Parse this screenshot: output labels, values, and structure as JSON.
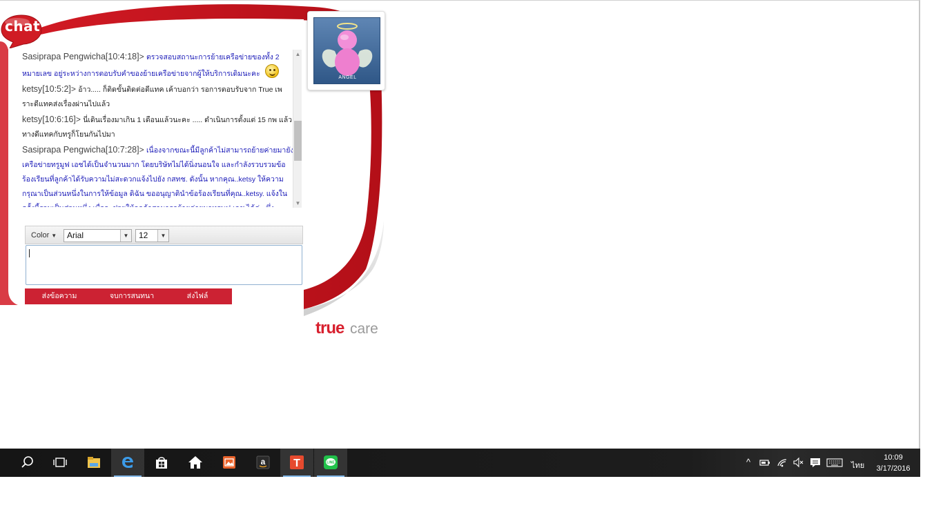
{
  "chat": {
    "bubble_label": "chat",
    "messages": [
      {
        "sender": "Sasiprapa Pengwicha",
        "time": "[10:4:18]",
        "sep": ">",
        "text": "ตรวจสอบสถานะการย้ายเครือข่ายของทั้ง 2 หมายเลข อยู่ระหว่างการตอบรับคำของย้ายเครือข่ายจากผู้ให้บริการเดิมนะคะ",
        "role": "agent",
        "emoticon": "smiley-icon"
      },
      {
        "sender": "ketsy",
        "time": "[10:5:2]",
        "sep": ">",
        "text": "อ้าว..... ก็ติดขั้นติดต่อดีแทค เค้าบอกว่า รอการตอบรับจาก True เพราะดีแทคส่งเรื่องผ่านไปแล้ว",
        "role": "user"
      },
      {
        "sender": "ketsy",
        "time": "[10:6:16]",
        "sep": ">",
        "text": "นี่เดินเรื่องมาเกิน 1 เดือนแล้วนะคะ ..... ดำเนินการตั้งแต่ 15 กพ แล้วทางดีแทคกับทรูก็โยนกันไปมา",
        "role": "user"
      },
      {
        "sender": "Sasiprapa Pengwicha",
        "time": "[10:7:28]",
        "sep": ">",
        "text": "เนื่องจากขณะนี้มีลูกค้าไม่สามารถย้ายค่ายมายังเครือข่ายทรูมูฟ เอชได้เป็นจำนวนมาก โดยบริษัทไม่ได้นิ่งนอนใจ และกำลังรวบรวมข้อร้องเรียนที่ลูกค้าได้รับความไม่สะดวกแจ้งไปยัง กสทช. ดังนั้น หากคุณ..ketsy ให้ความกรุณาเป็นส่วนหนึ่งในการให้ข้อมูล ดิฉัน ขออนุญาตินำข้อร้องเรียนที่คุณ..ketsy. แจ้งในครั้งนี้รวมเป็นส่วนหนึ่ง เพื่อจะช่วยให้ลูกค้าสามารถย้ายค่ายมาทรูมูฟ เอช ได้ค่ะ ซึ่ง",
        "role": "agent"
      }
    ],
    "toolbar": {
      "color_label": "Color",
      "font_value": "Arial",
      "size_value": "12"
    },
    "input_value": "",
    "actions": {
      "send": "ส่งข้อความ",
      "end": "จบการสนทนา",
      "send_file": "ส่งไฟล์"
    },
    "avatar": {
      "label": "ANGEL"
    }
  },
  "brand": {
    "true_text": "true",
    "care_text": "care",
    "accent_color": "#d8202e"
  },
  "taskbar": {
    "apps": [
      {
        "name": "search-icon"
      },
      {
        "name": "task-view-icon"
      },
      {
        "name": "file-explorer-icon"
      },
      {
        "name": "edge-browser-icon",
        "active": true
      },
      {
        "name": "store-icon"
      },
      {
        "name": "home-icon"
      },
      {
        "name": "photos-icon"
      },
      {
        "name": "amazon-icon"
      },
      {
        "name": "true-app-icon",
        "running": true
      },
      {
        "name": "line-app-icon",
        "running": true
      }
    ],
    "language": "ไทย",
    "time": "10:09",
    "date": "3/17/2016"
  }
}
